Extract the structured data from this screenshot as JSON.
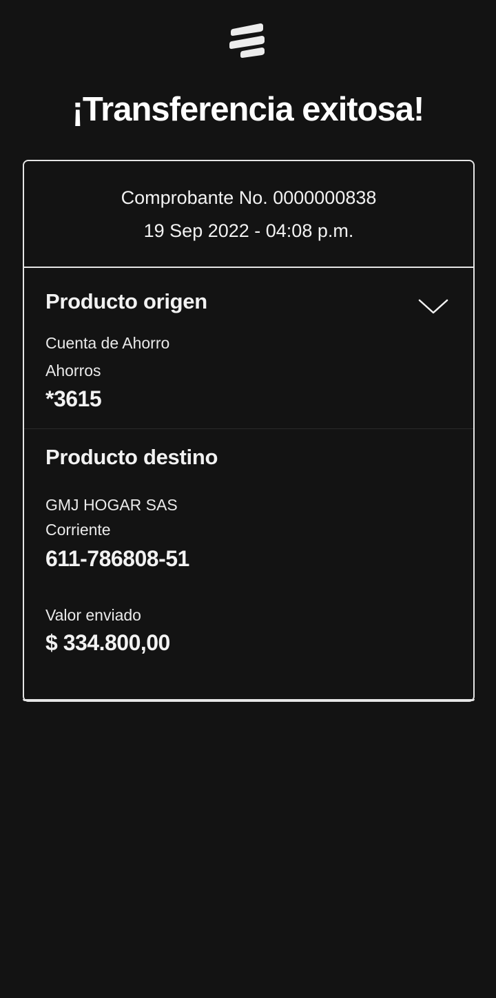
{
  "header": {
    "logo_icon": "bancolombia-logo-icon",
    "title": "¡Transferencia exitosa!"
  },
  "receipt": {
    "number_line": "Comprobante No. 0000000838",
    "datetime": "19 Sep 2022 - 04:08 p.m."
  },
  "origin": {
    "title": "Producto origen",
    "account_type": "Cuenta de Ahorro",
    "subtype": "Ahorros",
    "account_number": "*3615",
    "toggle_icon": "chevron-down-icon"
  },
  "destination": {
    "title": "Producto destino",
    "name": "GMJ HOGAR SAS",
    "account_type": "Corriente",
    "account_number": "611-786808-51",
    "amount_label": "Valor enviado",
    "amount": "$ 334.800,00"
  },
  "colors": {
    "background": "#131313",
    "text": "#f2f2f2",
    "border": "#e6e6e6"
  }
}
